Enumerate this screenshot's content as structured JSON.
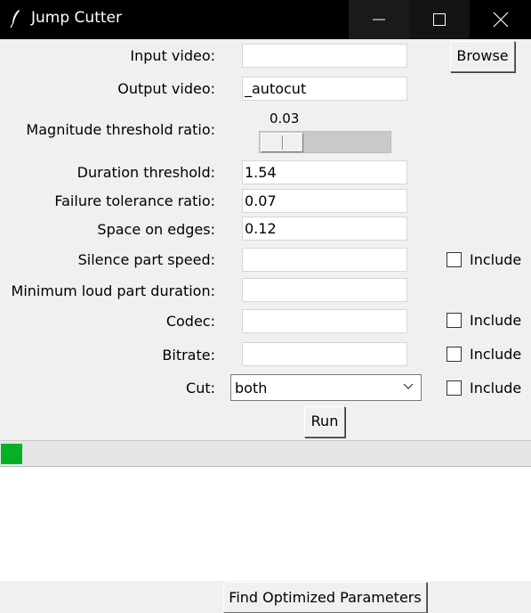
{
  "window": {
    "title": "Jump Cutter"
  },
  "form": {
    "input_video_label": "Input video:",
    "input_video_value": "",
    "browse_label": "Browse",
    "output_video_label": "Output video:",
    "output_video_value": "_autocut",
    "magnitude_label": "Magnitude threshold ratio:",
    "magnitude_value": "0.03",
    "duration_label": "Duration threshold:",
    "duration_value": "1.54",
    "failure_label": "Failure tolerance ratio:",
    "failure_value": "0.07",
    "space_label": "Space on edges:",
    "space_value": "0.12",
    "silence_label": "Silence part speed:",
    "silence_value": "",
    "min_loud_label": "Minimum loud part duration:",
    "min_loud_value": "",
    "codec_label": "Codec:",
    "codec_value": "",
    "bitrate_label": "Bitrate:",
    "bitrate_value": "",
    "cut_label": "Cut:",
    "cut_selected": "both",
    "include_label": "Include",
    "run_label": "Run",
    "find_label": "Find Optimized Parameters"
  },
  "progress": {
    "fraction": 0.04,
    "color": "#06b025"
  },
  "output": {
    "text": ""
  }
}
